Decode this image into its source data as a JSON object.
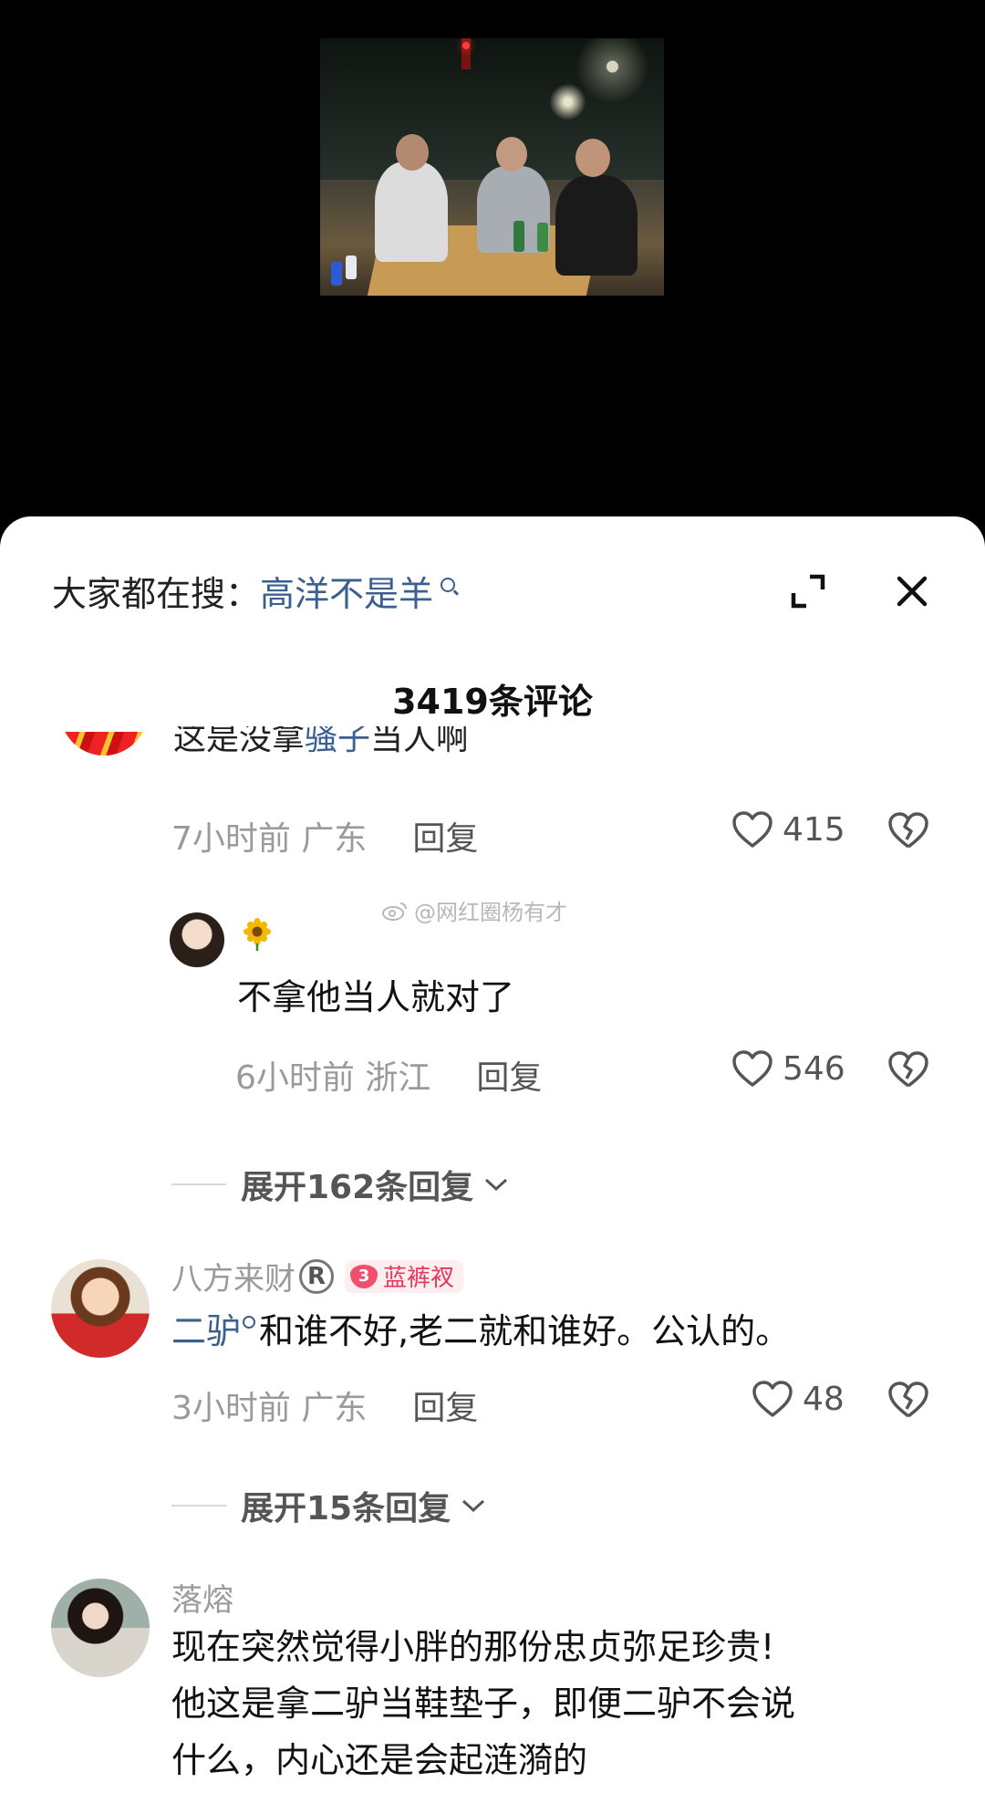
{
  "search_bar": {
    "prefix": "大家都在搜：",
    "term": "高洋不是羊"
  },
  "comment_count": "3419条评论",
  "comments": [
    {
      "cut_text_prefix": "这是没拿",
      "cut_text_highlight": "骚子",
      "cut_text_suffix": "当人啊",
      "time": "7小时前",
      "location": "广东",
      "reply_label": "回复",
      "likes": "415",
      "replies": [
        {
          "text": "不拿他当人就对了",
          "time": "6小时前",
          "location": "浙江",
          "reply_label": "回复",
          "likes": "546"
        }
      ],
      "expand_label": "展开162条回复"
    },
    {
      "username": "八方来财",
      "fan_badge_level": "3",
      "fan_badge_label": "蓝裤衩",
      "text_highlight": "二驴",
      "text": "和谁不好,老二就和谁好。公认的。",
      "time": "3小时前",
      "location": "广东",
      "reply_label": "回复",
      "likes": "48",
      "expand_label": "展开15条回复"
    },
    {
      "username": "落熔",
      "text_lines": [
        "现在突然觉得小胖的那份忠贞弥足珍贵!",
        "他这是拿二驴当鞋垫子，即便二驴不会说",
        "什么，内心还是会起涟漪的"
      ]
    }
  ],
  "watermark": "@网红圈杨有才",
  "icons": {
    "search": "search-icon",
    "expand": "expand-icon",
    "close": "close-icon",
    "like": "heart-icon",
    "dislike": "broken-heart-icon",
    "registered": "registered-icon",
    "sunflower": "sunflower-icon",
    "weibo": "weibo-icon"
  },
  "colors": {
    "link": "#3b5f8f",
    "meta": "#9a9a9a",
    "badge": "#e8365d"
  }
}
